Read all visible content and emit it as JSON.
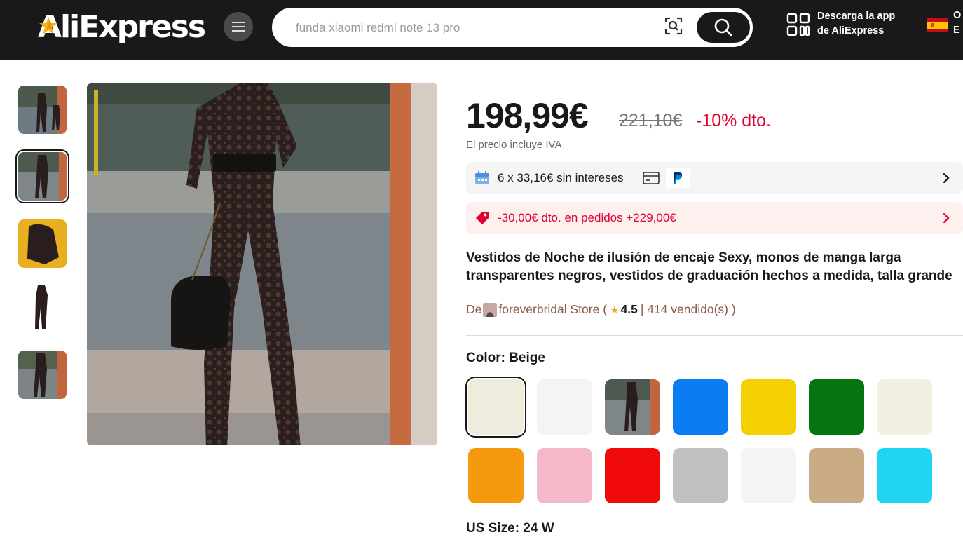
{
  "header": {
    "logo": "AliExpress",
    "search_placeholder": "funda xiaomi redmi note 13 pro",
    "app_line1": "Descarga la app",
    "app_line2": "de AliExpress",
    "lang_line1": "O",
    "lang_line2": "E",
    "icons": [
      "menu-icon",
      "camera-search-icon",
      "search-icon",
      "qr-code-icon",
      "spain-flag-icon"
    ]
  },
  "gallery": {
    "thumbnails": [
      "thumb-1",
      "thumb-2",
      "thumb-3",
      "thumb-4",
      "thumb-5"
    ],
    "active_index": 1
  },
  "product": {
    "price": "198,99€",
    "old_price": "221,10€",
    "discount": "-10% dto.",
    "vat_note": "El precio incluye IVA",
    "installments": "6 x 33,16€ sin intereses",
    "coupon": "-30,00€ dto. en pedidos +229,00€",
    "title_line1": "Vestidos de Noche de ilusión de encaje Sexy, monos de manga larga",
    "title_line2": "transparentes negros, vestidos de graduación hechos a medida, talla grande",
    "store_prefix": "De",
    "store_name": "foreverbridal Store (",
    "rating": "4.5",
    "sold": "| 414 vendido(s) )",
    "color_label": "Color: Beige",
    "size_label": "US Size: 24 W"
  },
  "colors": {
    "swatches": [
      "#efebdd",
      "#f4f4f4",
      "photo",
      "#0a7df2",
      "#f5d000",
      "#067411",
      "#f2f0e0",
      "#f59a0c",
      "#f4b8c8",
      "#f00a0a",
      "#c0c0c0",
      "#f4f4f4",
      "#c9ab85",
      "#1fd5f2"
    ],
    "selected_index": 0,
    "accent_red": "#e0002e",
    "header_bg": "#191919"
  }
}
